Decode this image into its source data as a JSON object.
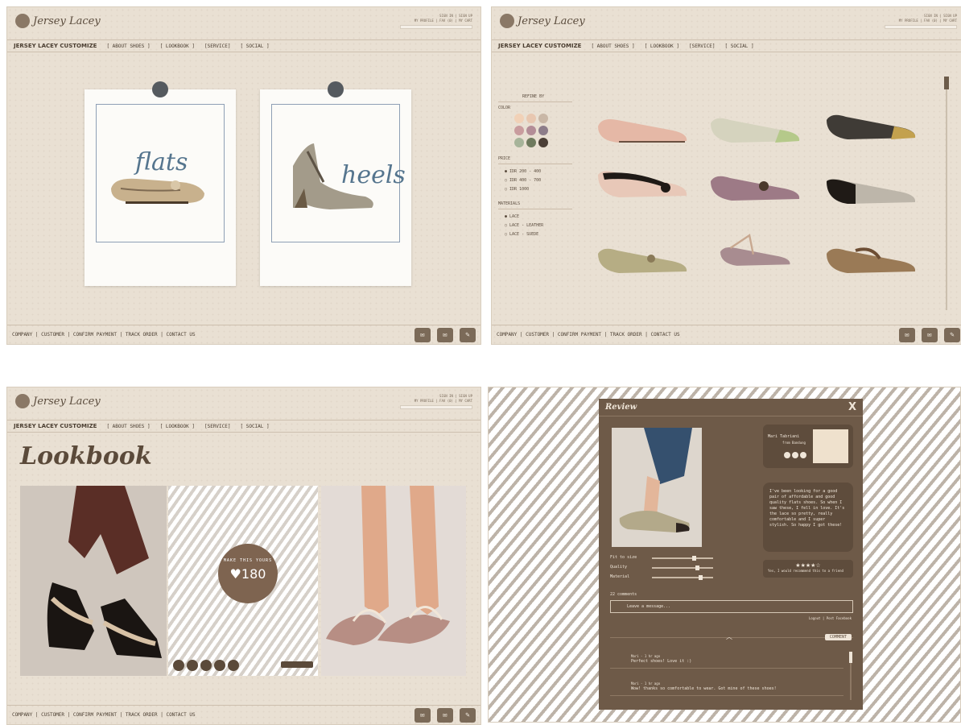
{
  "site": {
    "logo_text": "Jersey Lacey",
    "brand": "JERSEY LACEY CUSTOMIZE",
    "top_links": "SIGN IN | SIGN UP",
    "top_links2": "MY PROFILE | FAV (0) | MY CART"
  },
  "nav": {
    "about": "[ ABOUT SHOES ]",
    "lookbook": "[ LOOKBOOK ]",
    "service": "[SERVICE]",
    "social": "[ SOCIAL ]"
  },
  "footer": {
    "links": "COMPANY | CUSTOMER | CONFIRM PAYMENT | TRACK ORDER | CONTACT US"
  },
  "panel1": {
    "card1_label": "flats",
    "card2_label": "heels"
  },
  "panel2": {
    "refine": "REFINE BY",
    "color": "COLOR",
    "colors": [
      "#f1d1b7",
      "#e8c7b0",
      "#c9b7a6",
      "#c99c9e",
      "#b38d97",
      "#8d7d8a",
      "#a7b49a",
      "#6f7a5e",
      "#4b3f36"
    ],
    "price_label": "PRICE",
    "prices": [
      "IDR 200 - 400",
      "IDR 400 - 700",
      "IDR 1000"
    ],
    "material_label": "MATERIALS",
    "materials": [
      "LACE",
      "LACE - LEATHER",
      "LACE - SUEDE"
    ]
  },
  "panel3": {
    "title": "Lookbook",
    "like_label": "MAKE THIS YOURS",
    "like_count": "♥180"
  },
  "panel4": {
    "modal_title": "Review",
    "close": "X",
    "reviewer_name": "Mari Tabriani",
    "reviewer_sub": "from Bandung",
    "quote": "I've been looking for a good pair of affordable and good quality flats shoes. So when I saw these, I fell in love. It's the lace so pretty, really comfortable and I super stylish. So happy I got these!",
    "rating_stars": "★★★★☆",
    "rating_note": "Yes, I would recommend this to a friend",
    "sliders": [
      "Fit to size",
      "Quality",
      "Material"
    ],
    "comments_label": "22 comments",
    "comment_placeholder": "Leave a message...",
    "login_note": "Logout | Post Facebook",
    "comment_button": "COMMENT",
    "comments": [
      {
        "author": "Mari - 1 hr ago",
        "text": "Perfect shoes! Love it :)"
      },
      {
        "author": "Mari - 1 hr ago",
        "text": "Wow! thanks so comfortable to wear. Got mine of these shoes!"
      }
    ]
  }
}
